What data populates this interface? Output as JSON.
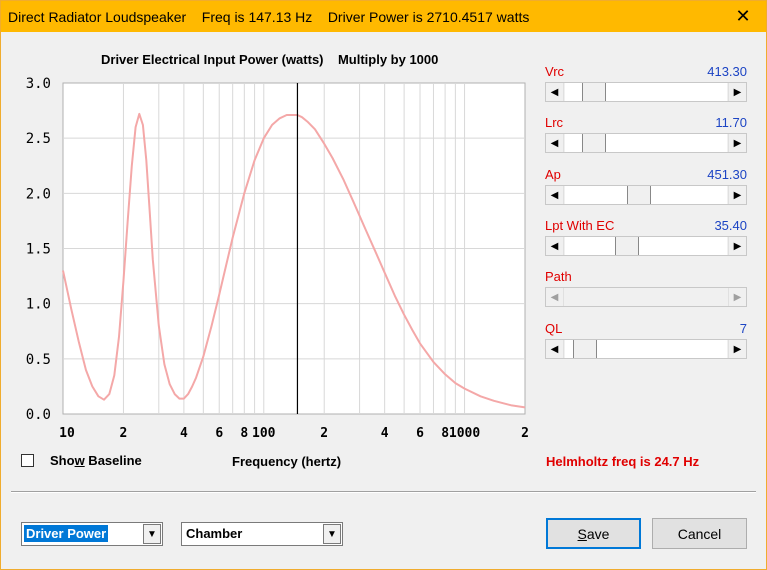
{
  "window": {
    "title": "Direct Radiator Loudspeaker    Freq is 147.13 Hz    Driver Power is 2710.4517 watts",
    "close_label": "✕"
  },
  "chart_title": "Driver Electrical Input Power (watts)    Multiply by 1000",
  "x_axis_label": "Frequency (hertz)",
  "helmholtz_text": "Helmholtz freq is 24.7 Hz",
  "show_baseline": {
    "label_pre": "Sho",
    "label_u": "w",
    "label_post": " Baseline",
    "checked": false
  },
  "sliders": [
    {
      "name": "Vrc",
      "value": "413.30",
      "position": 0.12,
      "enabled": true
    },
    {
      "name": "Lrc",
      "value": "11.70",
      "position": 0.12,
      "enabled": true
    },
    {
      "name": "Ap",
      "value": "451.30",
      "position": 0.44,
      "enabled": true
    },
    {
      "name": "Lpt  With EC",
      "value": "35.40",
      "position": 0.36,
      "enabled": true
    },
    {
      "name": "Path",
      "value": "",
      "position": 0.0,
      "enabled": false
    },
    {
      "name": "QL",
      "value": "7",
      "position": 0.06,
      "enabled": true
    }
  ],
  "plot_selector": {
    "value": "Driver Power"
  },
  "chamber_selector": {
    "value": "Chamber"
  },
  "buttons": {
    "save": {
      "pre": "",
      "u": "S",
      "post": "ave"
    },
    "cancel": "Cancel"
  },
  "colors": {
    "curve": "#f4a8a8",
    "cursor": "#000000",
    "title_bar": "#ffb900",
    "label_red": "#e00000",
    "value_blue": "#1c44c4"
  },
  "chart_data": {
    "type": "line",
    "title": "Driver Electrical Input Power (watts)    Multiply by 1000",
    "xlabel": "Frequency (hertz)",
    "ylabel": "",
    "x_scale": "log",
    "xlim": [
      10,
      2000
    ],
    "ylim": [
      0,
      3.0
    ],
    "y_ticks": [
      "0.0",
      "0.5",
      "1.0",
      "1.5",
      "2.0",
      "2.5",
      "3.0"
    ],
    "x_ticks": [
      {
        "value": 10,
        "label": "10"
      },
      {
        "value": 20,
        "label": "2"
      },
      {
        "value": 40,
        "label": "4"
      },
      {
        "value": 60,
        "label": "6"
      },
      {
        "value": 80,
        "label": "8"
      },
      {
        "value": 100,
        "label": "100"
      },
      {
        "value": 200,
        "label": "2"
      },
      {
        "value": 400,
        "label": "4"
      },
      {
        "value": 600,
        "label": "6"
      },
      {
        "value": 800,
        "label": "8"
      },
      {
        "value": 1000,
        "label": "1000"
      },
      {
        "value": 2000,
        "label": "2"
      }
    ],
    "cursor_x": 147.13,
    "series": [
      {
        "x": [
          10,
          11,
          12,
          13,
          14,
          15,
          16,
          17,
          18,
          19,
          20,
          21,
          22,
          23,
          24,
          25,
          26,
          27,
          28,
          30,
          32,
          34,
          36,
          38,
          40,
          42,
          44,
          46,
          50,
          55,
          60,
          65,
          70,
          80,
          90,
          100,
          110,
          120,
          130,
          140,
          147,
          155,
          165,
          180,
          200,
          220,
          250,
          280,
          320,
          360,
          400,
          450,
          500,
          550,
          600,
          700,
          800,
          900,
          1000,
          1200,
          1400,
          1700,
          2000
        ],
        "y": [
          1.3,
          0.95,
          0.65,
          0.4,
          0.25,
          0.16,
          0.13,
          0.18,
          0.35,
          0.7,
          1.2,
          1.75,
          2.25,
          2.6,
          2.72,
          2.62,
          2.3,
          1.85,
          1.4,
          0.8,
          0.45,
          0.27,
          0.18,
          0.14,
          0.14,
          0.18,
          0.25,
          0.33,
          0.52,
          0.8,
          1.08,
          1.35,
          1.6,
          2.0,
          2.3,
          2.5,
          2.62,
          2.68,
          2.71,
          2.71,
          2.71,
          2.69,
          2.65,
          2.58,
          2.45,
          2.32,
          2.12,
          1.92,
          1.68,
          1.47,
          1.28,
          1.07,
          0.9,
          0.76,
          0.64,
          0.47,
          0.36,
          0.28,
          0.23,
          0.16,
          0.12,
          0.08,
          0.06
        ]
      }
    ]
  }
}
